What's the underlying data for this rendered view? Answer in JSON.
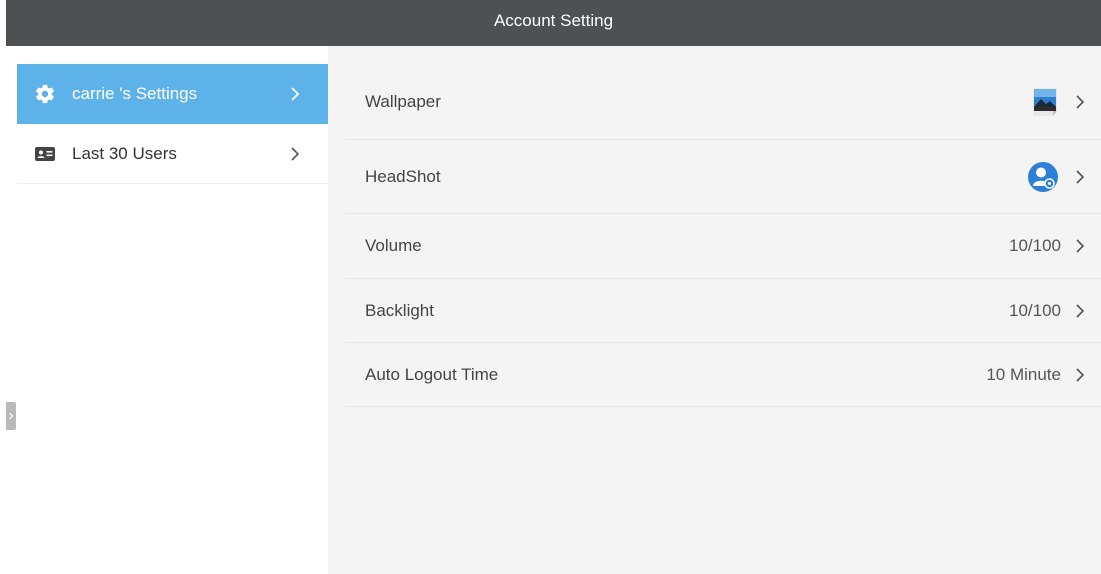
{
  "header": {
    "title": "Account Setting",
    "background": "#4e5154"
  },
  "sidebar": {
    "accent": "#5db2ea",
    "items": [
      {
        "label": "carrie 's Settings",
        "icon": "gear-icon",
        "active": true
      },
      {
        "label": "Last 30 Users",
        "icon": "id-card-icon",
        "active": false
      }
    ]
  },
  "settings": {
    "rows": [
      {
        "label": "Wallpaper",
        "value": "",
        "thumbnail": "wallpaper-thumbnail-icon"
      },
      {
        "label": "HeadShot",
        "value": "",
        "thumbnail": "headshot-avatar-icon"
      },
      {
        "label": "Volume",
        "value": "10/100"
      },
      {
        "label": "Backlight",
        "value": "10/100"
      },
      {
        "label": "Auto Logout Time",
        "value": "10 Minute"
      }
    ]
  },
  "icons": {
    "chevron": "chevron-right-icon",
    "edge_handle": "drawer-handle-icon"
  }
}
